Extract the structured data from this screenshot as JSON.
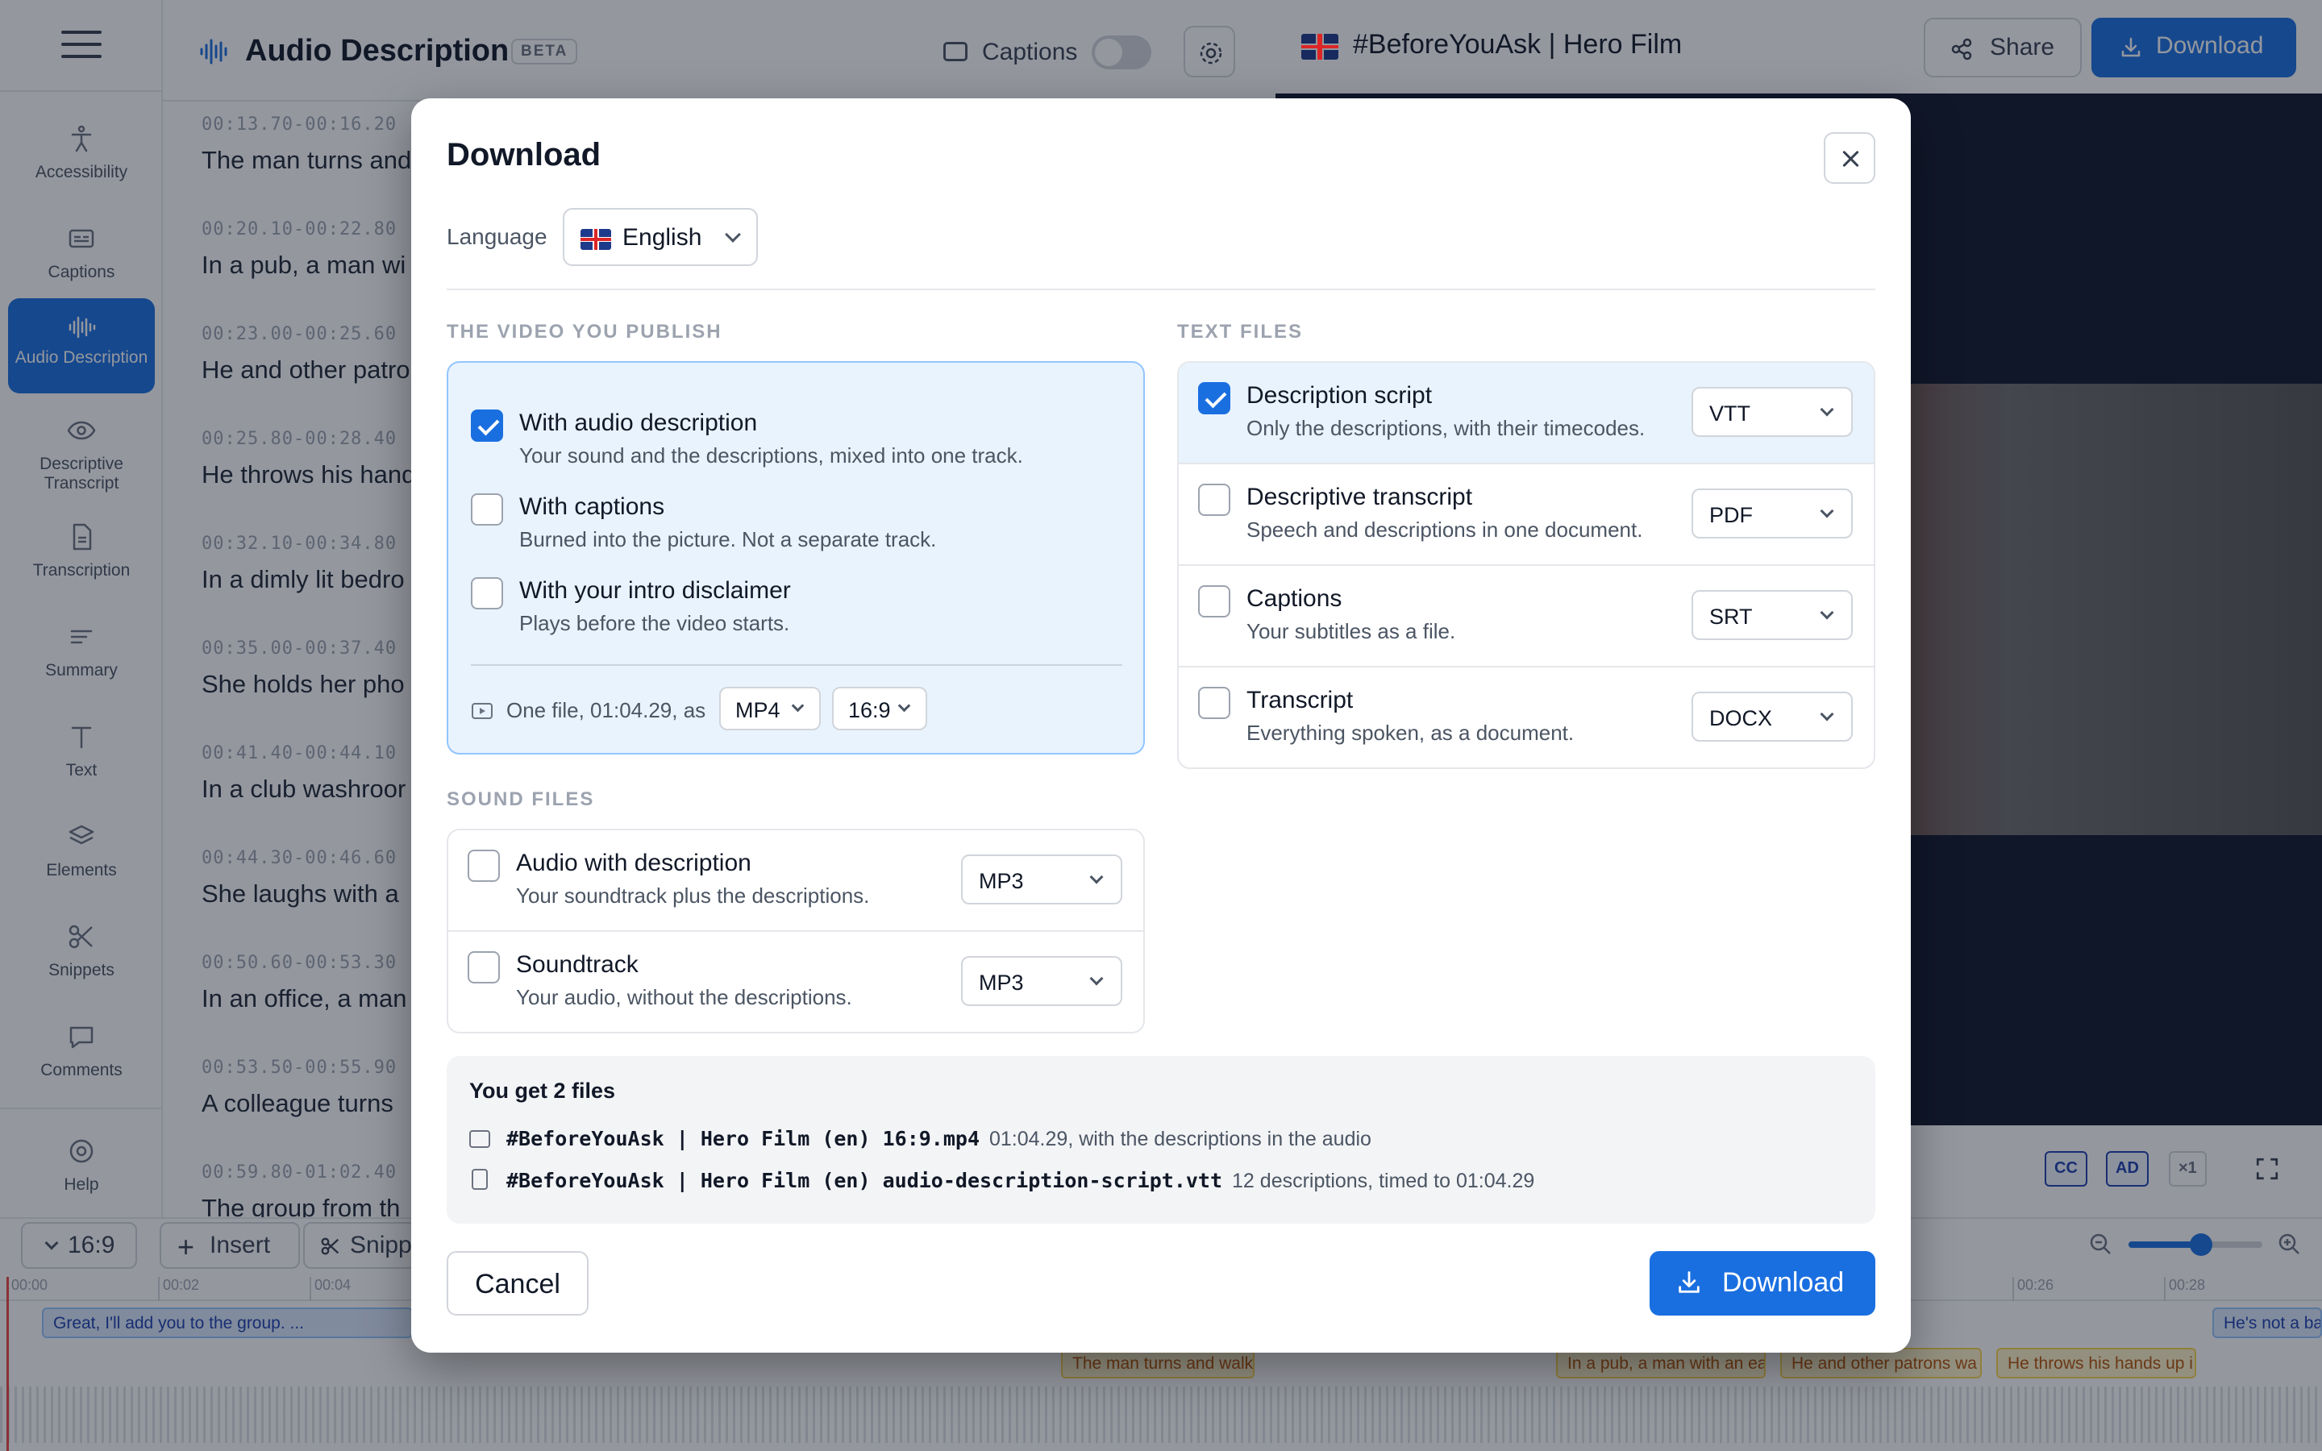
{
  "sidebar": {
    "items": [
      {
        "label": "Accessibility",
        "icon": "accessibility-icon"
      },
      {
        "label": "Captions",
        "icon": "captions-icon"
      },
      {
        "label": "Audio Description",
        "icon": "waveform-icon"
      },
      {
        "label": "Descriptive Transcript",
        "icon": "eye-icon"
      },
      {
        "label": "Transcription",
        "icon": "document-icon"
      },
      {
        "label": "Summary",
        "icon": "summary-icon"
      },
      {
        "label": "Text",
        "icon": "text-icon"
      },
      {
        "label": "Elements",
        "icon": "layers-icon"
      },
      {
        "label": "Snippets",
        "icon": "scissors-icon"
      },
      {
        "label": "Comments",
        "icon": "comment-icon"
      },
      {
        "label": "Help",
        "icon": "help-icon"
      }
    ]
  },
  "editor": {
    "title": "Audio Description",
    "badge": "BETA",
    "captions_label": "Captions",
    "segments": [
      {
        "tc": "00:13.70-00:16.20",
        "text": "The man turns and"
      },
      {
        "tc": "00:20.10-00:22.80",
        "text": "In a pub, a man wi"
      },
      {
        "tc": "00:23.00-00:25.60",
        "text": "He and other patro"
      },
      {
        "tc": "00:25.80-00:28.40",
        "text": "He throws his hand"
      },
      {
        "tc": "00:32.10-00:34.80",
        "text": "In a dimly lit bedro"
      },
      {
        "tc": "00:35.00-00:37.40",
        "text": "She holds her pho"
      },
      {
        "tc": "00:41.40-00:44.10",
        "text": "In a club washroor"
      },
      {
        "tc": "00:44.30-00:46.60",
        "text": "She laughs with a"
      },
      {
        "tc": "00:50.60-00:53.30",
        "text": "In an office, a man"
      },
      {
        "tc": "00:53.50-00:55.90",
        "text": "A colleague turns"
      },
      {
        "tc": "00:59.80-01:02.40",
        "text": "The group from th"
      }
    ]
  },
  "video_panel": {
    "title": "#BeforeYouAsk | Hero Film",
    "share_label": "Share",
    "download_label": "Download",
    "controls": [
      "CC",
      "AD",
      "×1"
    ]
  },
  "timeline": {
    "aspect": "16:9",
    "insert": "Insert",
    "snippet": "Snipp",
    "ticks": [
      "00:00",
      "00:02",
      "00:04",
      "00:26",
      "00:28"
    ],
    "clips": {
      "caption_first": "Great, I'll add you to the group. ...",
      "caption_last": "He's not a ba",
      "ad": [
        "The man turns and walk",
        "In a pub, a man with an ea",
        "He and other patrons wa",
        "He throws his hands up i"
      ]
    }
  },
  "modal": {
    "title": "Download",
    "language_label": "Language",
    "language_value": "English",
    "video_section": "THE VIDEO YOU PUBLISH",
    "video_options": [
      {
        "title": "With audio description",
        "desc": "Your sound and the descriptions, mixed into one track.",
        "checked": true
      },
      {
        "title": "With captions",
        "desc": "Burned into the picture. Not a separate track.",
        "checked": false
      },
      {
        "title": "With your intro disclaimer",
        "desc": "Plays before the video starts.",
        "checked": false
      }
    ],
    "video_summary": "One file, 01:04.29, as",
    "video_format": "MP4",
    "video_aspect": "16:9",
    "sound_section": "SOUND FILES",
    "sound_files": [
      {
        "title": "Audio with description",
        "desc": "Your soundtrack plus the descriptions.",
        "format": "MP3",
        "checked": false
      },
      {
        "title": "Soundtrack",
        "desc": "Your audio, without the descriptions.",
        "format": "MP3",
        "checked": false
      }
    ],
    "text_section": "TEXT FILES",
    "text_files": [
      {
        "title": "Description script",
        "desc": "Only the descriptions, with their timecodes.",
        "format": "VTT",
        "checked": true
      },
      {
        "title": "Descriptive transcript",
        "desc": "Speech and descriptions in one document.",
        "format": "PDF",
        "checked": false
      },
      {
        "title": "Captions",
        "desc": "Your subtitles as a file.",
        "format": "SRT",
        "checked": false
      },
      {
        "title": "Transcript",
        "desc": "Everything spoken, as a document.",
        "format": "DOCX",
        "checked": false
      }
    ],
    "summary_title": "You get 2 files",
    "summary_files": [
      {
        "name": "#BeforeYouAsk | Hero Film (en) 16:9.mp4",
        "note": "01:04.29, with the descriptions in the audio"
      },
      {
        "name": "#BeforeYouAsk | Hero Film (en) audio-description-script.vtt",
        "note": "12 descriptions, timed to 01:04.29"
      }
    ],
    "cancel_label": "Cancel",
    "download_label": "Download"
  },
  "colors": {
    "accent": "#1a6fe0",
    "selected_bg": "#e8f3fd"
  }
}
